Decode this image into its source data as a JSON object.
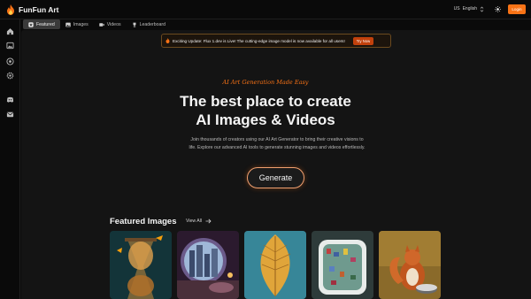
{
  "app": {
    "name": "FunFun Art"
  },
  "tabs": [
    {
      "label": "Featured",
      "icon": "star-badge-icon",
      "active": true
    },
    {
      "label": "Images",
      "icon": "image-icon",
      "active": false
    },
    {
      "label": "Videos",
      "icon": "video-icon",
      "active": false
    },
    {
      "label": "Leaderboard",
      "icon": "trophy-icon",
      "active": false
    }
  ],
  "header": {
    "language": "English",
    "language_code": "US",
    "login_label": "Login",
    "theme_icon": "sun-icon"
  },
  "sidebar": {
    "items": [
      {
        "name": "home",
        "icon": "home-icon"
      },
      {
        "name": "gallery",
        "icon": "gallery-icon"
      },
      {
        "name": "create",
        "icon": "target-icon"
      },
      {
        "name": "settings",
        "icon": "gear-icon"
      },
      {
        "name": "discord",
        "icon": "discord-icon"
      },
      {
        "name": "mail",
        "icon": "mail-icon"
      }
    ]
  },
  "announcement": {
    "text": "Exciting Update: Flux 1.dev is Live! The cutting-edge image model is now available for all users!",
    "button": "Try Now",
    "icon": "flame-icon"
  },
  "hero": {
    "tagline": "AI Art Generation Made Easy",
    "headline_line1": "The best place to create",
    "headline_line2": "AI Images & Videos",
    "subtext": "Join thousands of creators using our AI Art Generator to bring their creative visions to life. Explore our advanced AI tools to generate stunning images and videos effortlessly.",
    "cta": "Generate"
  },
  "featured": {
    "title": "Featured Images",
    "view_all": "View All",
    "images": [
      {
        "subject": "hourglass-with-butterflies"
      },
      {
        "subject": "city-through-round-window"
      },
      {
        "subject": "autumn-leaf-on-blue-wall"
      },
      {
        "subject": "miniature-bathtub-city"
      },
      {
        "subject": "squirrel-drummer"
      }
    ]
  },
  "colors": {
    "accent": "#f97316",
    "background": "#0a0a0a",
    "panel": "#141414"
  }
}
